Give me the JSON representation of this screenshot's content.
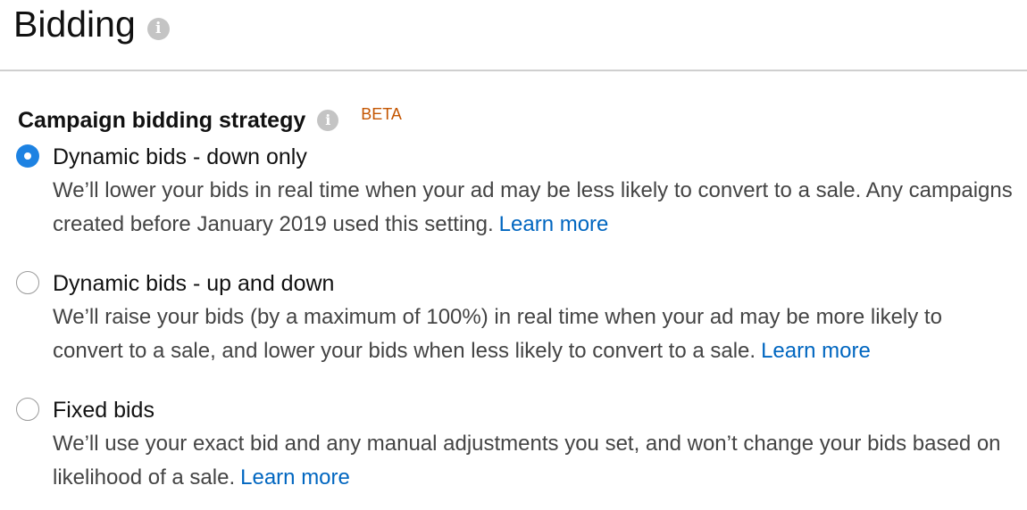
{
  "header": {
    "title": "Bidding",
    "info_icon": "info-icon"
  },
  "campaign_bidding": {
    "label": "Campaign bidding strategy",
    "info_icon": "info-icon",
    "badge": "BETA",
    "badge_color": "#c45500",
    "selected": "Dynamic bids - down only",
    "options": [
      {
        "label": "Dynamic bids - down only",
        "description": "We’ll lower your bids in real time when your ad may be less likely to convert to a sale. Any campaigns created before January 2019 used this setting.",
        "link": "Learn more",
        "checked": true
      },
      {
        "label": "Dynamic bids - up and down",
        "description": "We’ll raise your bids (by a maximum of 100%) in real time when your ad may be more likely to convert to a sale, and lower your bids when less likely to convert to a sale.",
        "link": "Learn more",
        "checked": false
      },
      {
        "label": "Fixed bids",
        "description": "We’ll use your exact bid and any manual adjustments you set, and won’t change your bids based on likelihood of a sale.",
        "link": "Learn more",
        "checked": false
      }
    ]
  },
  "colors": {
    "accent": "#1d82e2",
    "link": "#0066c0",
    "divider": "#cfcfcf"
  }
}
